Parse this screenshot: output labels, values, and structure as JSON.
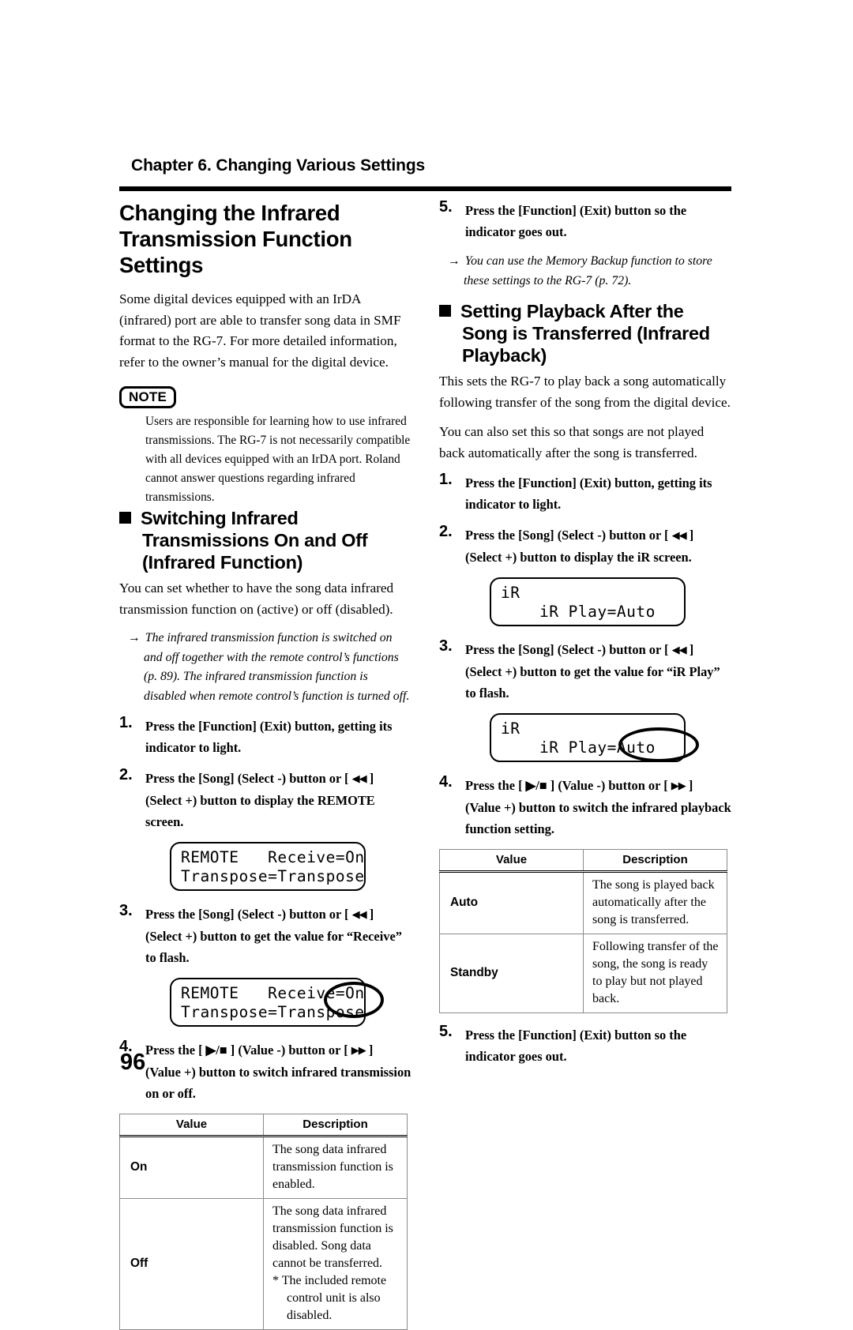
{
  "header": {
    "chapter": "Chapter 6. Changing Various Settings"
  },
  "page_number": "96",
  "left_column": {
    "title": "Changing the Infrared Transmission Function Settings",
    "intro": "Some digital devices equipped with an IrDA (infrared) port are able to transfer song data in SMF format to the RG-7. For more detailed information, refer to the owner’s manual for the digital device.",
    "note": {
      "badge": "NOTE",
      "text": "Users are responsible for learning how to use infrared transmissions. The RG-7 is not necessarily compatible with all devices equipped with an IrDA port. Roland cannot answer questions regarding infrared transmissions."
    },
    "section": {
      "heading": "Switching Infrared Transmissions On and Off (Infrared Function)",
      "intro": "You can set whether to have the song data infrared transmission function on (active) or off (disabled).",
      "arrow_note": "The infrared transmission function is switched on and off together with the remote control’s functions (p. 89). The infrared transmission function is disabled when remote control’s function is turned off."
    },
    "steps": [
      {
        "num": "1.",
        "text_before": "Press the [Function] (Exit) button, getting its indicator to light.",
        "glyph": "",
        "text_after": ""
      },
      {
        "num": "2.",
        "text_before": "Press the [Song] (Select -) button or [ ",
        "glyph": "◀◀",
        "text_after": " ] (Select +) button to display the REMOTE screen."
      },
      {
        "num": "3.",
        "text_before": "Press the [Song] (Select -) button or [ ",
        "glyph": "◀◀",
        "text_after": " ] (Select +) button to get the value for “Receive” to flash."
      },
      {
        "num": "4.",
        "text_before": "Press the [ ▶/■ ] (Value -) button or [ ",
        "glyph": "▶▶",
        "text_after": " ] (Value +) button to switch infrared transmission on or off."
      }
    ],
    "lcd_1": {
      "line1": "REMOTE   Receive=On",
      "line2": "Transpose=Transpose",
      "highlight": false
    },
    "lcd_2": {
      "line1": "REMOTE   Receive=On",
      "line2": "Transpose=Transpose",
      "highlight": true,
      "highlight_target": "=On"
    },
    "table": {
      "headers": [
        "Value",
        "Description"
      ],
      "rows": [
        {
          "value": "On",
          "description": "The song data infrared transmission function is enabled.",
          "footnote": ""
        },
        {
          "value": "Off",
          "description": "The song data infrared transmission function is disabled. Song data cannot be transferred.",
          "footnote": "*  The included remote control unit is also disabled."
        }
      ]
    }
  },
  "right_column": {
    "step5_top": {
      "num": "5.",
      "text": "Press the [Function] (Exit) button so the indicator goes out."
    },
    "arrow_note_top": "You can use the Memory Backup function to store these settings to the RG-7 (p. 72).",
    "section": {
      "heading": "Setting Playback After the Song is Transferred (Infrared Playback)",
      "intro1": "This sets the RG-7 to play back a song automatically following transfer of the song from the digital device.",
      "intro2": "You can also set this so that songs are not played back automatically after the song is transferred."
    },
    "steps": [
      {
        "num": "1.",
        "text_before": "Press the [Function] (Exit) button, getting its indicator to light.",
        "glyph": "",
        "text_after": ""
      },
      {
        "num": "2.",
        "text_before": "Press the [Song] (Select -) button or [ ",
        "glyph": "◀◀",
        "text_after": " ] (Select +) button to display the iR screen."
      },
      {
        "num": "3.",
        "text_before": "Press the [Song] (Select -) button or [ ",
        "glyph": "◀◀",
        "text_after": " ] (Select +) button to get the value for “iR Play” to flash."
      },
      {
        "num": "4.",
        "text_before": "Press the [ ▶/■ ] (Value -) button or [ ",
        "glyph": "▶▶",
        "text_after": " ] (Value +) button to switch the infrared playback function setting."
      }
    ],
    "lcd_1": {
      "line1": "iR",
      "line2": "    iR Play=Auto",
      "highlight": false
    },
    "lcd_2": {
      "line1": "iR",
      "line2": "    iR Play=Auto",
      "highlight": true,
      "highlight_target": "=Auto"
    },
    "table": {
      "headers": [
        "Value",
        "Description"
      ],
      "rows": [
        {
          "value": "Auto",
          "description": "The song is played back automatically after the song is transferred."
        },
        {
          "value": "Standby",
          "description": "Following transfer of the song, the song is ready to play but not played back."
        }
      ]
    },
    "step5_bottom": {
      "num": "5.",
      "text": "Press the [Function] (Exit) button so the indicator goes out."
    }
  }
}
